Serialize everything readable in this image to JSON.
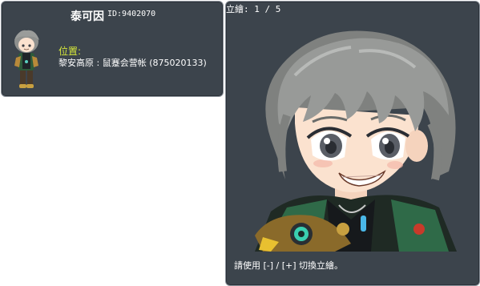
{
  "npc": {
    "name": "泰可因",
    "id_text": "ID:9402070",
    "location_label": "位置:",
    "location_value": "黎安高原 : 鼠蹇会营帐 (875020133)"
  },
  "portrait": {
    "label": "立繪:",
    "current": "1",
    "separator": "/",
    "total": "5",
    "hint": "請使用 [-] / [+] 切換立繪。"
  },
  "colors": {
    "panel_bg": "#3c444c",
    "panel_border": "#8a9199",
    "location_label": "#d4e63a",
    "hair": "#8e908e",
    "eyes": "#5a5e66",
    "skin": "#fbe2cf"
  }
}
